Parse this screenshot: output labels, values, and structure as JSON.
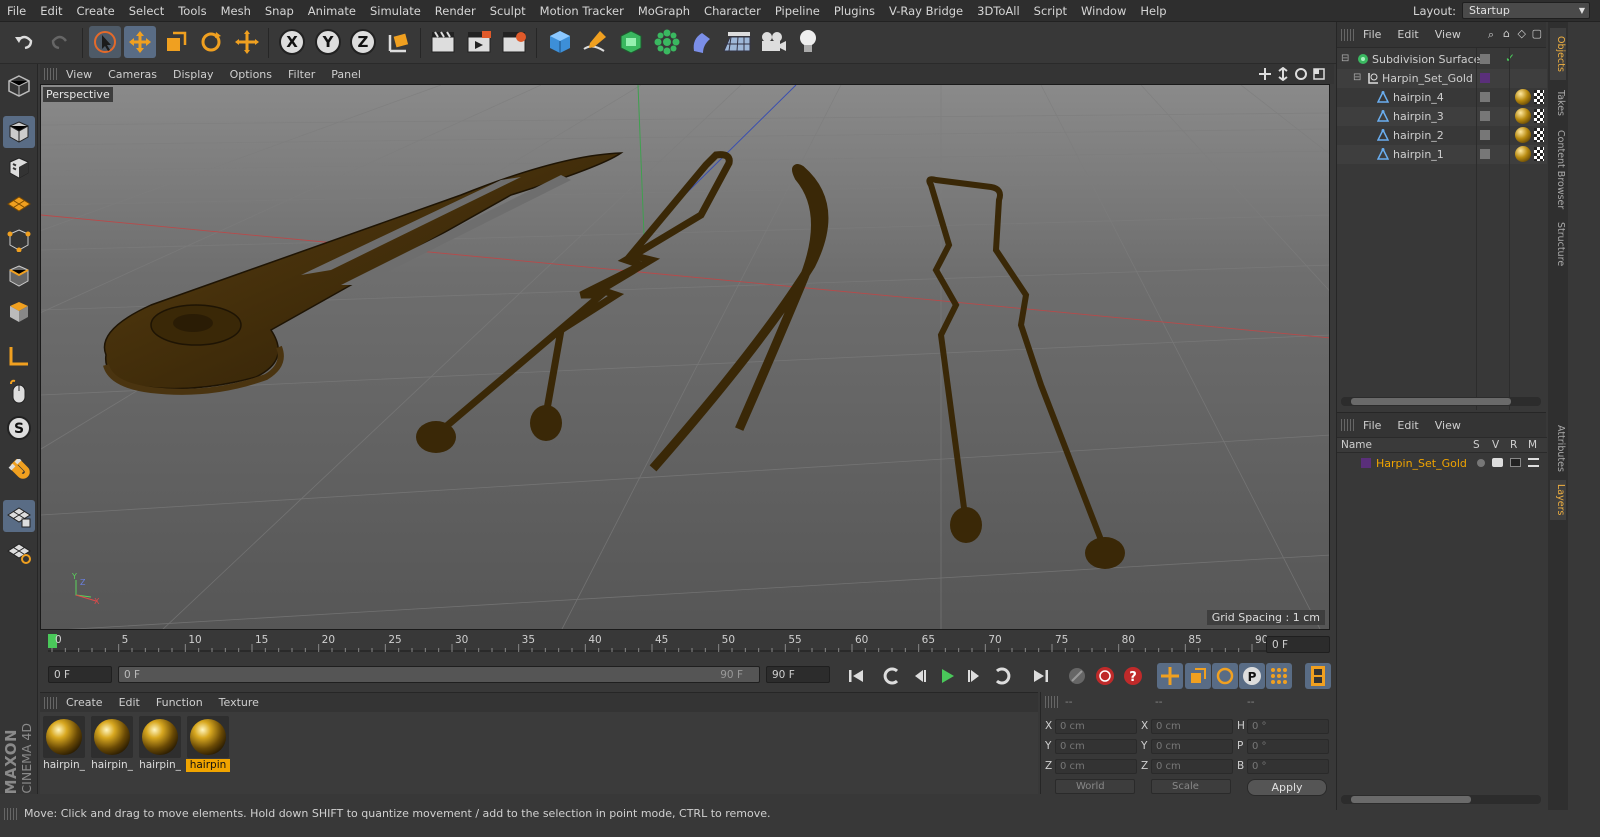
{
  "menubar": {
    "items": [
      "File",
      "Edit",
      "Create",
      "Select",
      "Tools",
      "Mesh",
      "Snap",
      "Animate",
      "Simulate",
      "Render",
      "Sculpt",
      "Motion Tracker",
      "MoGraph",
      "Character",
      "Pipeline",
      "Plugins",
      "V-Ray Bridge",
      "3DToAll",
      "Script",
      "Window",
      "Help"
    ],
    "layout_label": "Layout:",
    "layout_value": "Startup"
  },
  "toolbar": {
    "axis_x": "X",
    "axis_y": "Y",
    "axis_z": "Z"
  },
  "viewport": {
    "menu": [
      "View",
      "Cameras",
      "Display",
      "Options",
      "Filter",
      "Panel"
    ],
    "camera_label": "Perspective",
    "grid_spacing": "Grid Spacing : 1 cm"
  },
  "timeline": {
    "ticks": [
      "0",
      "5",
      "10",
      "15",
      "20",
      "25",
      "30",
      "35",
      "40",
      "45",
      "50",
      "55",
      "60",
      "65",
      "70",
      "75",
      "80",
      "85",
      "90"
    ],
    "current_frame": 0,
    "end_field": "0 F",
    "start_field": "0 F",
    "slider_left": "0 F",
    "slider_right": "90 F",
    "max_field": "90 F"
  },
  "materials": {
    "menu": [
      "Create",
      "Edit",
      "Function",
      "Texture"
    ],
    "items": [
      {
        "label": "hairpin_",
        "selected": false
      },
      {
        "label": "hairpin_",
        "selected": false
      },
      {
        "label": "hairpin_",
        "selected": false
      },
      {
        "label": "hairpin",
        "selected": true
      }
    ]
  },
  "coordinates": {
    "headers": [
      "--",
      "--",
      "--"
    ],
    "rows": [
      {
        "a": "X",
        "av": "0 cm",
        "b": "X",
        "bv": "0 cm",
        "c": "H",
        "cv": "0 °"
      },
      {
        "a": "Y",
        "av": "0 cm",
        "b": "Y",
        "bv": "0 cm",
        "c": "P",
        "cv": "0 °"
      },
      {
        "a": "Z",
        "av": "0 cm",
        "b": "Z",
        "bv": "0 cm",
        "c": "B",
        "cv": "0 °"
      }
    ],
    "mode": "World",
    "scale": "Scale",
    "apply": "Apply"
  },
  "status": {
    "text": "Move: Click and drag to move elements. Hold down SHIFT to quantize movement / add to the selection in point mode, CTRL to remove."
  },
  "logo": {
    "line1": "MAXON",
    "line2": "CINEMA 4D"
  },
  "objects_panel": {
    "menu": [
      "File",
      "Edit",
      "View"
    ],
    "tree": [
      {
        "name": "Subdivision Surface",
        "indent": 0,
        "type": "subdiv"
      },
      {
        "name": "Harpin_Set_Gold",
        "indent": 1,
        "type": "null"
      },
      {
        "name": "hairpin_4",
        "indent": 2,
        "type": "poly"
      },
      {
        "name": "hairpin_3",
        "indent": 2,
        "type": "poly"
      },
      {
        "name": "hairpin_2",
        "indent": 2,
        "type": "poly"
      },
      {
        "name": "hairpin_1",
        "indent": 2,
        "type": "poly"
      }
    ]
  },
  "layers_panel": {
    "menu": [
      "File",
      "Edit",
      "View"
    ],
    "columns": [
      "Name",
      "S",
      "V",
      "R",
      "M"
    ],
    "layers": [
      {
        "name": "Harpin_Set_Gold",
        "color": "#5a2f7a"
      }
    ]
  },
  "side_tabs": [
    "Objects",
    "Takes",
    "Content Browser",
    "Structure",
    "Attributes",
    "Layers"
  ],
  "colors": {
    "accent": "#f0a400",
    "highlight": "#596c85",
    "gold": "#3d2a0a"
  }
}
